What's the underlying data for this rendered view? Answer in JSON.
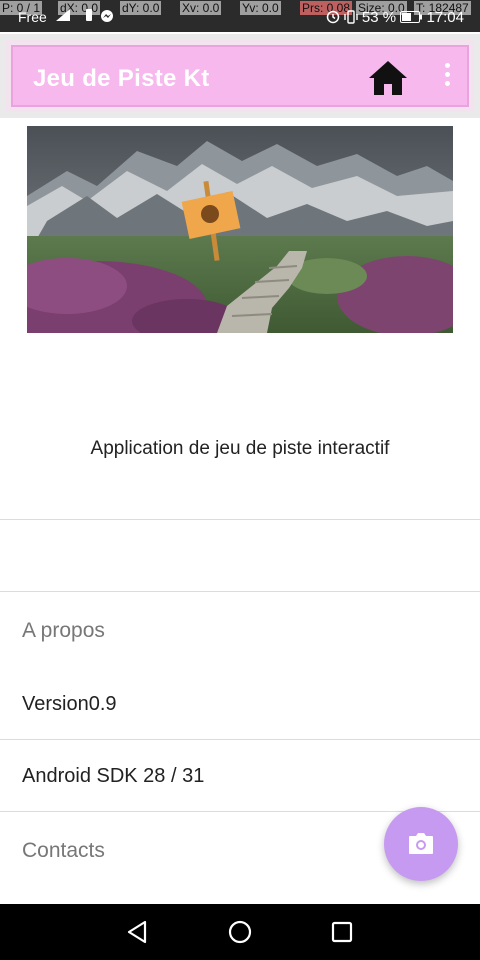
{
  "status_bar": {
    "debug": {
      "p": "P: 0 / 1",
      "dx": "dX: 0.0",
      "dy": "dY: 0.0",
      "xv": "Xv: 0.0",
      "yv": "Yv: 0.0",
      "prs": "Prs: 0.08",
      "size": "Size: 0.0",
      "t": "T: 182487"
    },
    "carrier": "Free",
    "battery": "53 %",
    "time": "17:04"
  },
  "app_bar": {
    "title": "Jeu de Piste Kt",
    "background_color": "#f7b8ee",
    "home_icon": "home-icon",
    "menu_icon": "more-vert-icon"
  },
  "main": {
    "description": "Application de jeu de piste interactif"
  },
  "info": {
    "about_label": "A propos",
    "version": "Version0.9",
    "sdk": "Android SDK 28 / 31",
    "contacts_label": "Contacts"
  },
  "fab": {
    "icon": "camera-icon",
    "color": "#c69af0"
  },
  "nav_bar": {
    "back_icon": "back-triangle-icon",
    "home_icon": "home-circle-icon",
    "recents_icon": "recents-square-icon"
  }
}
